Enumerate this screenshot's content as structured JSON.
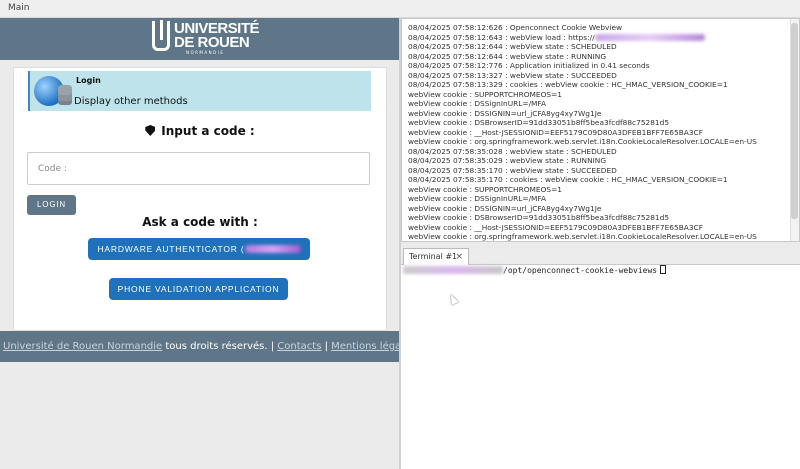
{
  "titlebar": {
    "menu_label": "Main"
  },
  "header": {
    "logo_line1": "UNIVERSITÉ",
    "logo_line2": "DE ROUEN",
    "logo_line3": "NORMANDIE"
  },
  "auth": {
    "method_title": "Login",
    "method_subtitle": "Display other methods",
    "heading": "Input a code :",
    "code_placeholder": "Code :",
    "login_button": "LOGIN",
    "ask_heading": "Ask a code with :",
    "hardware_button": "HARDWARE AUTHENTICATOR (",
    "phone_button": "PHONE VALIDATION APPLICATION"
  },
  "footer": {
    "org_link": "Université de Rouen Normandie",
    "rights_text": " tous droits réservés. | ",
    "contacts_link": "Contacts",
    "separator": " | ",
    "legal_link": "Mentions légales"
  },
  "log": {
    "lines": [
      "08/04/2025 07:58:12:626 : Openconnect Cookie Webview",
      "08/04/2025 07:58:12:643 : webView load : https://",
      "08/04/2025 07:58:12:644 : webView state : SCHEDULED",
      "08/04/2025 07:58:12:644 : webView state : RUNNING",
      "08/04/2025 07:58:12:776 : Application initialized in 0.41 seconds",
      "08/04/2025 07:58:13:327 : webView state : SUCCEEDED",
      "08/04/2025 07:58:13:329 : cookies : webView cookie : HC_HMAC_VERSION_COOKIE=1",
      "webView cookie : SUPPORTCHROMEOS=1",
      "webView cookie : DSSignInURL=/MFA",
      "webView cookie : DSSIGNIN=url_jCFA8yg4xy7Wg1Je",
      "webView cookie : DSBrowserID=91dd33051b8ff5bea3fcdf88c75281d5",
      "webView cookie : __Host-JSESSIONID=EEF5179C09D80A3DFEB1BFF7E65BA3CF",
      "webView cookie : org.springframework.web.servlet.i18n.CookieLocaleResolver.LOCALE=en-US",
      "08/04/2025 07:58:35:028 : webView state : SCHEDULED",
      "08/04/2025 07:58:35:029 : webView state : RUNNING",
      "08/04/2025 07:58:35:170 : webView state : SUCCEEDED",
      "08/04/2025 07:58:35:170 : cookies : webView cookie : HC_HMAC_VERSION_COOKIE=1",
      "webView cookie : SUPPORTCHROMEOS=1",
      "webView cookie : DSSignInURL=/MFA",
      "webView cookie : DSSIGNIN=url_jCFA8yg4xy7Wg1Je",
      "webView cookie : DSBrowserID=91dd33051b8ff5bea3fcdf88c75281d5",
      "webView cookie : __Host-JSESSIONID=EEF5179C09D80A3DFEB1BFF7E65BA3CF",
      "webView cookie : org.springframework.web.servlet.i18n.CookieLocaleResolver.LOCALE=en-US"
    ]
  },
  "terminal": {
    "tab_label": "Terminal #1",
    "tab_close": "×",
    "prompt_path": "/opt/openconnect-cookie-webviews"
  },
  "colors": {
    "header_bg": "#5e7688",
    "button_blue": "#2071bb",
    "method_bg": "#bfe3eb"
  },
  "icons": [
    "shield-icon",
    "globe-icon",
    "disk-stack-icon",
    "close-icon",
    "mouse-pointer-icon"
  ]
}
